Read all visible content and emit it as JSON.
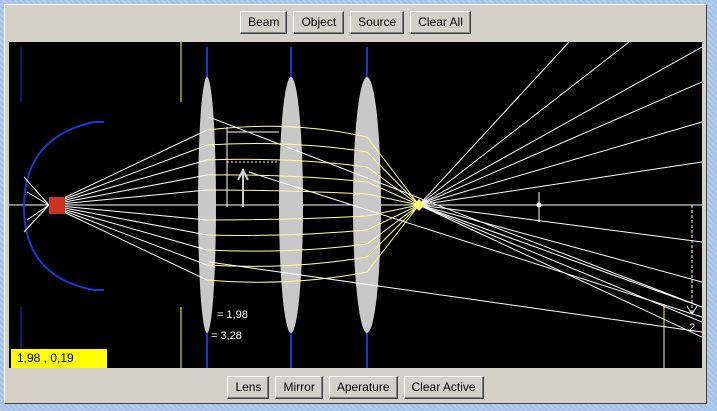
{
  "toolbar_top": {
    "beam_label": "Beam",
    "object_label": "Object",
    "source_label": "Source",
    "clear_all_label": "Clear All"
  },
  "toolbar_bottom": {
    "lens_label": "Lens",
    "mirror_label": "Mirror",
    "aperture_label": "Aperature",
    "clear_active_label": "Clear Active"
  },
  "canvas": {
    "coordinate_readout": "1,98 , 0,19",
    "focal_label_1": "= 1,98",
    "focal_label_2": "= 3,28",
    "marker_label": "2"
  },
  "colors": {
    "background_canvas": "#000000",
    "ray": "#ffffff",
    "ray_secondary": "#ffff99",
    "lens_fill": "#c8c8c8",
    "lens_axis": "#2233cc",
    "mirror": "#2233cc",
    "source": "#cc3322",
    "readout_bg": "#ffff00"
  }
}
